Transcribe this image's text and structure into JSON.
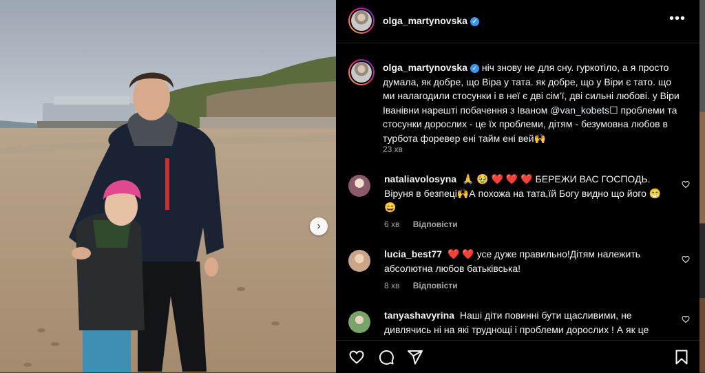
{
  "post": {
    "username": "olga_martynovska",
    "caption_text": "ніч знову не для сну. гуркотіло, а я просто думала, як добре, що Віра у тата. як добре, що у Віри є тато. що ми налагодили стосунки і в неї є дві сім’ї, дві сильні любові. у Віри Іванівни нарешті побачення з Іваном",
    "caption_mention": "@van_kobets",
    "caption_text_2": "☐ проблеми та стосунки дорослих - це їх проблеми, дітям - безумовна любов в турбота форевер ені тайм ені вей🙌",
    "time": "23 хв"
  },
  "comments": [
    {
      "username": "nataliavolosyna",
      "text": "🙏 🥹 ❤️ ❤️ ❤️ БЕРЕЖИ ВАС ГОСПОДЬ. Віруня в безпеці🙌А похожа на тата,їй Богу видно що його 😁 😄",
      "time": "6 хв",
      "reply": "Відповісти",
      "avatar_color": "#8a5a6a"
    },
    {
      "username": "lucia_best77",
      "text": "❤️ ❤️ усе дуже правильно!Дітям належить абсолютна любов батьківська!",
      "time": "8 хв",
      "reply": "Відповісти",
      "avatar_color": "#c9a68a"
    },
    {
      "username": "tanyashavyrina",
      "text": "Наші діти повинні бути щасливими, не дивлячись ні на які труднощі і проблеми дорослих ! А як це",
      "avatar_color": "#7aa36a"
    }
  ],
  "actions": {
    "like_icon": "heart-icon",
    "comment_icon": "comment-icon",
    "share_icon": "share-icon",
    "save_icon": "bookmark-icon"
  },
  "colors": {
    "panel_bg": "#000000",
    "text": "#f5f5f5",
    "muted": "#a8a8a8",
    "verified": "#3897f0",
    "mention": "#e0f1ff"
  }
}
